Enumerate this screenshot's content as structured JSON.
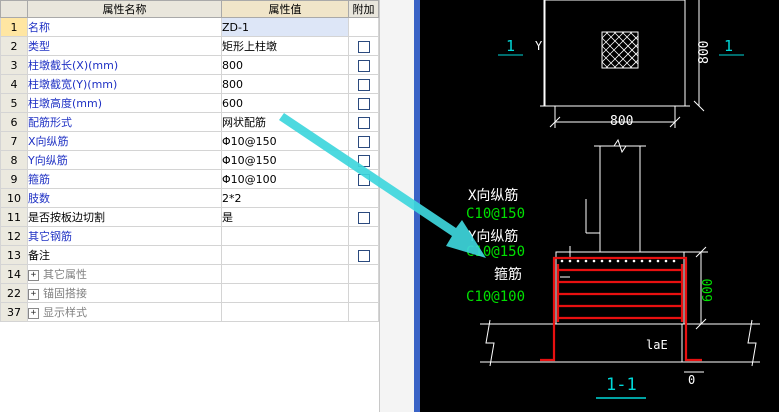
{
  "grid": {
    "headers": [
      "属性名称",
      "属性值",
      "附加"
    ],
    "rows": [
      {
        "num": "1",
        "name": "名称",
        "value": "ZD-1",
        "checkbox": false,
        "style": "blue",
        "selected": true
      },
      {
        "num": "2",
        "name": "类型",
        "value": "矩形上柱墩",
        "checkbox": true,
        "style": "blue"
      },
      {
        "num": "3",
        "name": "柱墩截长(X)(mm)",
        "value": "800",
        "checkbox": true,
        "style": "blue"
      },
      {
        "num": "4",
        "name": "柱墩截宽(Y)(mm)",
        "value": "800",
        "checkbox": true,
        "style": "blue"
      },
      {
        "num": "5",
        "name": "柱墩高度(mm)",
        "value": "600",
        "checkbox": true,
        "style": "blue"
      },
      {
        "num": "6",
        "name": "配筋形式",
        "value": "网状配筋",
        "checkbox": true,
        "style": "blue"
      },
      {
        "num": "7",
        "name": "X向纵筋",
        "value": "Φ10@150",
        "checkbox": true,
        "style": "blue"
      },
      {
        "num": "8",
        "name": "Y向纵筋",
        "value": "Φ10@150",
        "checkbox": true,
        "style": "blue"
      },
      {
        "num": "9",
        "name": "箍筋",
        "value": "Φ10@100",
        "checkbox": true,
        "style": "blue"
      },
      {
        "num": "10",
        "name": "肢数",
        "value": "2*2",
        "checkbox": false,
        "style": "blue"
      },
      {
        "num": "11",
        "name": "是否按板边切割",
        "value": "是",
        "checkbox": true,
        "style": "black"
      },
      {
        "num": "12",
        "name": "其它钢筋",
        "value": "",
        "checkbox": false,
        "style": "blue"
      },
      {
        "num": "13",
        "name": "备注",
        "value": "",
        "checkbox": true,
        "style": "black"
      },
      {
        "num": "14",
        "name": "其它属性",
        "value": "",
        "checkbox": false,
        "style": "grey",
        "expand": "+"
      },
      {
        "num": "22",
        "name": "锚固搭接",
        "value": "",
        "checkbox": false,
        "style": "grey",
        "expand": "+"
      },
      {
        "num": "37",
        "name": "显示样式",
        "value": "",
        "checkbox": false,
        "style": "grey",
        "expand": "+"
      }
    ]
  },
  "cad": {
    "plan": {
      "section_mark_left": "1",
      "section_mark_right": "1",
      "y_label": "Y",
      "dim_vertical": "800",
      "dim_horizontal": "800"
    },
    "section": {
      "x_bar_label": "X向纵筋",
      "x_bar_value": "C10@150",
      "y_bar_label": "Y向纵筋",
      "y_bar_value": "C10@150",
      "stirrup_label": "箍筋",
      "stirrup_value": "C10@100",
      "height_dim": "600",
      "anchor_label": "laE",
      "cover_dim": "0",
      "title": "1-1"
    }
  },
  "colors": {
    "cad_white": "#ffffff",
    "cad_cyan": "#00d8d8",
    "cad_green": "#00e000",
    "cad_red": "#e81010",
    "arrow": "#3ed6dc",
    "splitter": "#3a63c6"
  }
}
